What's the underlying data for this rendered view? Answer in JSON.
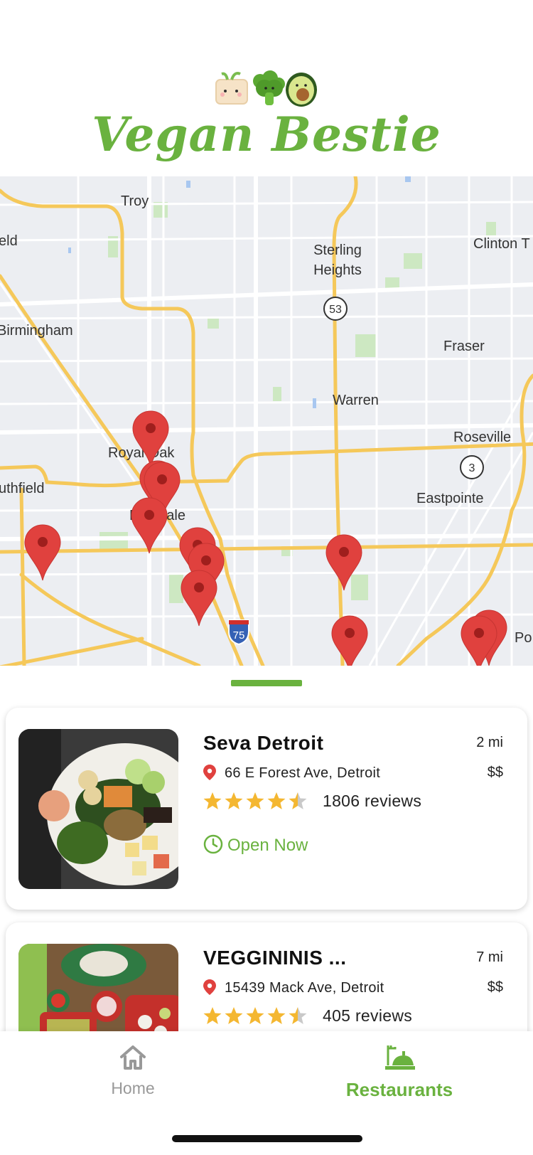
{
  "app": {
    "title": "Vegan Bestie",
    "mascots": [
      "tofu-mascot-icon",
      "broccoli-mascot-icon",
      "avocado-mascot-icon"
    ]
  },
  "colors": {
    "brand": "#6ab23f",
    "pin": "#e0413e",
    "star": "#f4b731"
  },
  "map": {
    "labels": [
      "Troy",
      "Sterling Heights",
      "Clinton T",
      "eld",
      "Birmingham",
      "Fraser",
      "Warren",
      "Royal Oak",
      "Roseville",
      "uthfield",
      "Eastpointe",
      "Ferndale",
      "Po"
    ],
    "shields": [
      "53",
      "3",
      "75"
    ]
  },
  "restaurants": [
    {
      "name": "Seva Detroit",
      "distance": "2 mi",
      "address": "66 E Forest Ave, Detroit",
      "price": "$$",
      "rating": 4.5,
      "reviews": "1806 reviews",
      "status": "Open Now"
    },
    {
      "name": "VEGGININIS ...",
      "distance": "7 mi",
      "address": "15439 Mack Ave, Detroit",
      "price": "$$",
      "rating": 4.5,
      "reviews": "405 reviews",
      "status": ""
    }
  ],
  "tabs": [
    {
      "label": "Home",
      "icon": "home-icon",
      "active": false
    },
    {
      "label": "Restaurants",
      "icon": "restaurant-icon",
      "active": true
    }
  ]
}
